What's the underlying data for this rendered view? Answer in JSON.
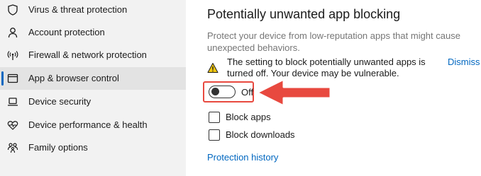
{
  "sidebar": {
    "items": [
      {
        "label": "Virus & threat protection",
        "icon": "shield-icon",
        "selected": false
      },
      {
        "label": "Account protection",
        "icon": "person-icon",
        "selected": false
      },
      {
        "label": "Firewall & network protection",
        "icon": "wifi-antenna-icon",
        "selected": false
      },
      {
        "label": "App & browser control",
        "icon": "app-window-icon",
        "selected": true
      },
      {
        "label": "Device security",
        "icon": "laptop-icon",
        "selected": false
      },
      {
        "label": "Device performance & health",
        "icon": "heart-pulse-icon",
        "selected": false
      },
      {
        "label": "Family options",
        "icon": "family-icon",
        "selected": false
      }
    ]
  },
  "main": {
    "title": "Potentially unwanted app blocking",
    "description": "Protect your device from low-reputation apps that might cause unexpected behaviors.",
    "warning": {
      "icon": "warning-icon",
      "text": "The setting to block potentially unwanted apps is turned off. Your device may be vulnerable.",
      "dismiss_label": "Dismiss"
    },
    "toggle": {
      "state_label": "Off",
      "on": false
    },
    "options": [
      {
        "label": "Block apps",
        "checked": false
      },
      {
        "label": "Block downloads",
        "checked": false
      }
    ],
    "history_link": "Protection history"
  },
  "colors": {
    "accent": "#0067c0",
    "sidebar_bg": "#f2f2f2",
    "selected_bg": "#e3e3e3",
    "warning": "#f2c811",
    "annotation": "#e8493f"
  }
}
